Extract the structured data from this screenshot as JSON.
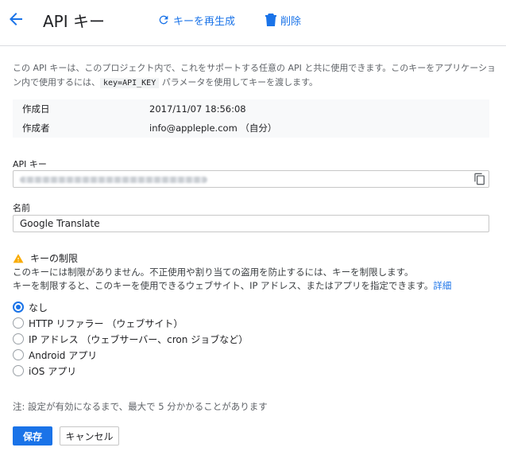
{
  "header": {
    "title": "API キー",
    "regenerate_label": "キーを再生成",
    "delete_label": "削除"
  },
  "description": {
    "part1": "この API キーは、このプロジェクト内で、これをサポートする任意の API と共に使用できます。このキーをアプリケーション内で使用するには、",
    "code": "key=API_KEY",
    "part2": " パラメータを使用してキーを渡します。"
  },
  "meta": {
    "rows": [
      {
        "key": "作成日",
        "value": "2017/11/07 18:56:08"
      },
      {
        "key": "作成者",
        "value": "info@appleple.com （自分）"
      }
    ]
  },
  "api_key": {
    "label": "API キー"
  },
  "name": {
    "label": "名前",
    "value": "Google Translate"
  },
  "restriction": {
    "title": "キーの制限",
    "line1": "このキーには制限がありません。不正使用や割り当ての盗用を防止するには、キーを制限します。",
    "line2": "キーを制限すると、このキーを使用できるウェブサイト、IP アドレス、またはアプリを指定できます。",
    "more_link": "詳細",
    "options": [
      {
        "label": "なし",
        "checked": true
      },
      {
        "label": "HTTP リファラー （ウェブサイト）",
        "checked": false
      },
      {
        "label": "IP アドレス （ウェブサーバー、cron ジョブなど）",
        "checked": false
      },
      {
        "label": "Android アプリ",
        "checked": false
      },
      {
        "label": "iOS アプリ",
        "checked": false
      }
    ]
  },
  "note": "注: 設定が有効になるまで、最大で 5 分かかることがあります",
  "actions": {
    "save": "保存",
    "cancel": "キャンセル"
  },
  "colors": {
    "accent": "#1a73e8",
    "warning": "#f9ab00"
  }
}
